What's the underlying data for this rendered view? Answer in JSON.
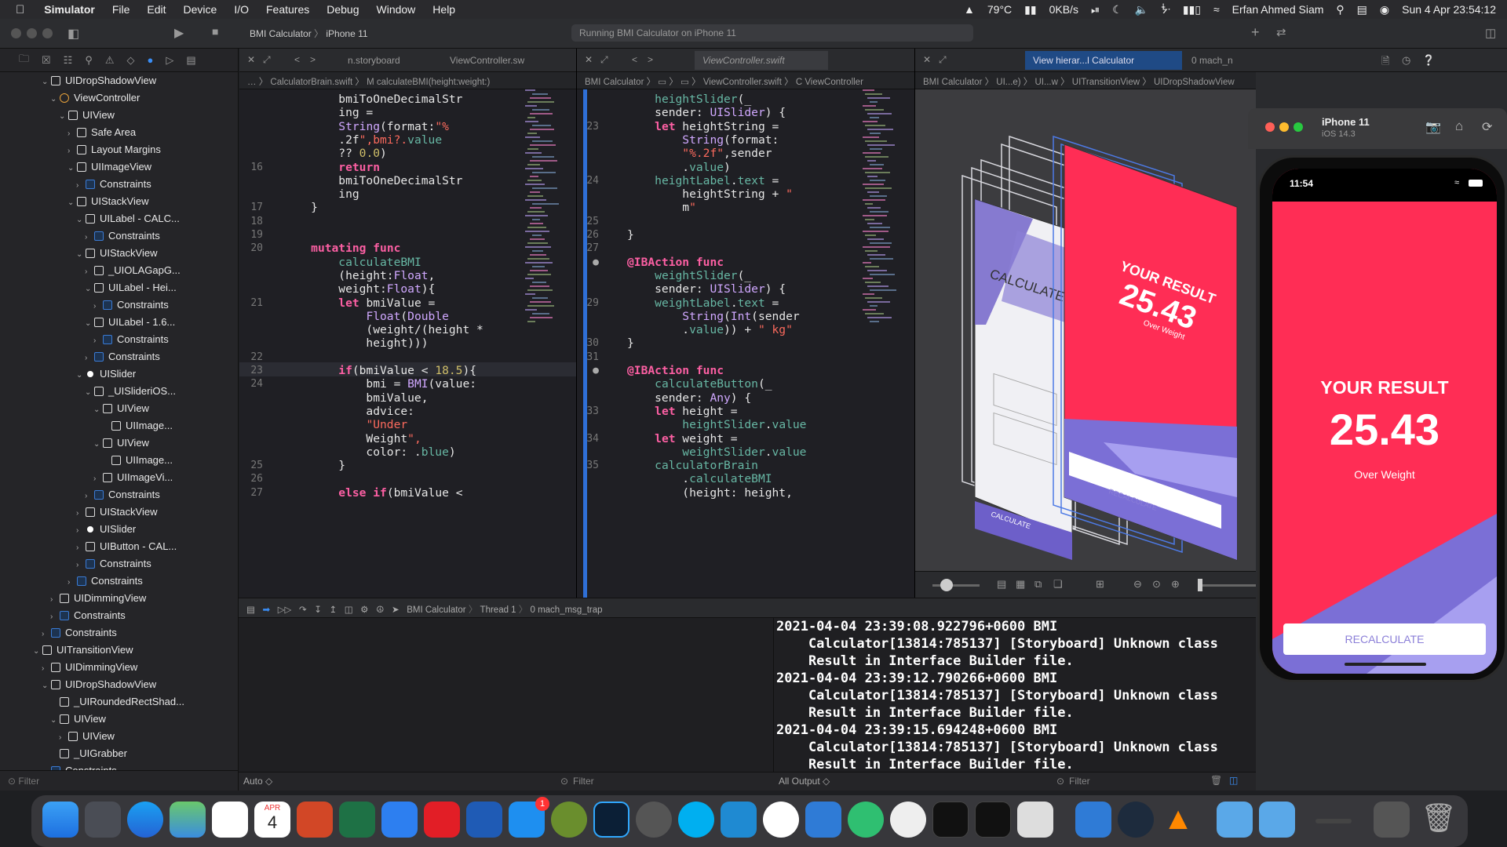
{
  "menubar": {
    "app": "Simulator",
    "items": [
      "File",
      "Edit",
      "Device",
      "I/O",
      "Features",
      "Debug",
      "Window",
      "Help"
    ],
    "temp": "79°C",
    "net": "0KB/s",
    "user": "Erfan Ahmed Siam",
    "clock": "Sun 4 Apr  23:54:12"
  },
  "toolbar": {
    "scheme": "BMI Calculator",
    "device": "iPhone 11",
    "activity": "Running BMI Calculator on iPhone 11"
  },
  "navigator": {
    "filter_placeholder": "Filter",
    "rows": [
      {
        "label": "UIDropShadowView",
        "indent": 5,
        "disc": "⌄",
        "icon": "view"
      },
      {
        "label": "ViewController",
        "indent": 6,
        "disc": "⌄",
        "icon": "vc"
      },
      {
        "label": "UIView",
        "indent": 7,
        "disc": "⌄",
        "icon": "view"
      },
      {
        "label": "Safe Area",
        "indent": 8,
        "disc": "›",
        "icon": "view"
      },
      {
        "label": "Layout Margins",
        "indent": 8,
        "disc": "›",
        "icon": "view"
      },
      {
        "label": "UIImageView",
        "indent": 8,
        "disc": "⌄",
        "icon": "view"
      },
      {
        "label": "Constraints",
        "indent": 9,
        "disc": "›",
        "icon": "cons"
      },
      {
        "label": "UIStackView",
        "indent": 8,
        "disc": "⌄",
        "icon": "view"
      },
      {
        "label": "UILabel - CALC...",
        "indent": 9,
        "disc": "⌄",
        "icon": "view"
      },
      {
        "label": "Constraints",
        "indent": 10,
        "disc": "›",
        "icon": "cons"
      },
      {
        "label": "UIStackView",
        "indent": 9,
        "disc": "⌄",
        "icon": "view"
      },
      {
        "label": "_UIOLAGapG...",
        "indent": 10,
        "disc": "›",
        "icon": "view"
      },
      {
        "label": "UILabel - Hei...",
        "indent": 10,
        "disc": "⌄",
        "icon": "view"
      },
      {
        "label": "Constraints",
        "indent": 11,
        "disc": "›",
        "icon": "cons"
      },
      {
        "label": "UILabel - 1.6...",
        "indent": 10,
        "disc": "⌄",
        "icon": "view"
      },
      {
        "label": "Constraints",
        "indent": 11,
        "disc": "›",
        "icon": "cons"
      },
      {
        "label": "Constraints",
        "indent": 10,
        "disc": "›",
        "icon": "cons"
      },
      {
        "label": "UISlider",
        "indent": 9,
        "disc": "⌄",
        "icon": "dot"
      },
      {
        "label": "_UISlideriOS...",
        "indent": 10,
        "disc": "⌄",
        "icon": "view"
      },
      {
        "label": "UIView",
        "indent": 11,
        "disc": "⌄",
        "icon": "view"
      },
      {
        "label": "UIImage...",
        "indent": 12,
        "disc": "",
        "icon": "view"
      },
      {
        "label": "UIView",
        "indent": 11,
        "disc": "⌄",
        "icon": "view"
      },
      {
        "label": "UIImage...",
        "indent": 12,
        "disc": "",
        "icon": "view"
      },
      {
        "label": "UIImageVi...",
        "indent": 11,
        "disc": "›",
        "icon": "view"
      },
      {
        "label": "Constraints",
        "indent": 10,
        "disc": "›",
        "icon": "cons"
      },
      {
        "label": "UIStackView",
        "indent": 9,
        "disc": "›",
        "icon": "view"
      },
      {
        "label": "UISlider",
        "indent": 9,
        "disc": "›",
        "icon": "dot"
      },
      {
        "label": "UIButton - CAL...",
        "indent": 9,
        "disc": "›",
        "icon": "view"
      },
      {
        "label": "Constraints",
        "indent": 9,
        "disc": "›",
        "icon": "cons"
      },
      {
        "label": "Constraints",
        "indent": 8,
        "disc": "›",
        "icon": "cons"
      },
      {
        "label": "UIDimmingView",
        "indent": 6,
        "disc": "›",
        "icon": "view"
      },
      {
        "label": "Constraints",
        "indent": 6,
        "disc": "›",
        "icon": "cons"
      },
      {
        "label": "Constraints",
        "indent": 5,
        "disc": "›",
        "icon": "cons"
      },
      {
        "label": "UITransitionView",
        "indent": 4,
        "disc": "⌄",
        "icon": "view"
      },
      {
        "label": "UIDimmingView",
        "indent": 5,
        "disc": "›",
        "icon": "view"
      },
      {
        "label": "UIDropShadowView",
        "indent": 5,
        "disc": "⌄",
        "icon": "view"
      },
      {
        "label": "_UIRoundedRectShad...",
        "indent": 6,
        "disc": "",
        "icon": "view"
      },
      {
        "label": "UIView",
        "indent": 6,
        "disc": "⌄",
        "icon": "view"
      },
      {
        "label": "UIView",
        "indent": 7,
        "disc": "›",
        "icon": "view"
      },
      {
        "label": "_UIGrabber",
        "indent": 6,
        "disc": "",
        "icon": "view"
      },
      {
        "label": "Constraints",
        "indent": 5,
        "disc": "›",
        "icon": "cons"
      }
    ]
  },
  "editor1": {
    "tab": "n.storyboard",
    "tab2": "ViewController.sw",
    "jump": "…  〉 CalculatorBrain.swift 〉 M  calculateBMI(height:weight:)",
    "lines": [
      {
        "n": "",
        "t": "        bmiToOneDecimalStr"
      },
      {
        "n": "",
        "t": "        ing ="
      },
      {
        "n": "",
        "t": "        String(format:\"%"
      },
      {
        "n": "",
        "t": "        .2f\",bmi?.value"
      },
      {
        "n": "",
        "t": "        ?? 0.0)"
      },
      {
        "n": "16",
        "t": "        return"
      },
      {
        "n": "",
        "t": "        bmiToOneDecimalStr"
      },
      {
        "n": "",
        "t": "        ing"
      },
      {
        "n": "17",
        "t": "    }"
      },
      {
        "n": "18",
        "t": ""
      },
      {
        "n": "19",
        "t": ""
      },
      {
        "n": "20",
        "t": "    mutating func"
      },
      {
        "n": "",
        "t": "        calculateBMI"
      },
      {
        "n": "",
        "t": "        (height:Float,"
      },
      {
        "n": "",
        "t": "        weight:Float){"
      },
      {
        "n": "21",
        "t": "        let bmiValue ="
      },
      {
        "n": "",
        "t": "            Float(Double"
      },
      {
        "n": "",
        "t": "            (weight/(height *"
      },
      {
        "n": "",
        "t": "            height)))"
      },
      {
        "n": "22",
        "t": ""
      },
      {
        "n": "23",
        "t": "        if(bmiValue < 18.5){"
      },
      {
        "n": "24",
        "t": "            bmi = BMI(value:"
      },
      {
        "n": "",
        "t": "            bmiValue,"
      },
      {
        "n": "",
        "t": "            advice:"
      },
      {
        "n": "",
        "t": "            \"Under"
      },
      {
        "n": "",
        "t": "            Weight\","
      },
      {
        "n": "",
        "t": "            color: .blue)"
      },
      {
        "n": "25",
        "t": "        }"
      },
      {
        "n": "26",
        "t": ""
      },
      {
        "n": "27",
        "t": "        else if(bmiValue <"
      }
    ]
  },
  "editor2": {
    "tab": "ViewController.swift",
    "jump": "BMI Calculator 〉 ▭ 〉 ▭ 〉 ViewController.swift 〉 C  ViewController",
    "lines": [
      {
        "n": "",
        "t": "    heightSlider(_"
      },
      {
        "n": "",
        "t": "    sender: UISlider) {"
      },
      {
        "n": "23",
        "t": "    let heightString ="
      },
      {
        "n": "",
        "t": "        String(format:"
      },
      {
        "n": "",
        "t": "        \"%.2f\",sender"
      },
      {
        "n": "",
        "t": "        .value)"
      },
      {
        "n": "24",
        "t": "    heightLabel.text ="
      },
      {
        "n": "",
        "t": "        heightString + \""
      },
      {
        "n": "",
        "t": "        m\""
      },
      {
        "n": "25",
        "t": ""
      },
      {
        "n": "26",
        "t": "}"
      },
      {
        "n": "27",
        "t": ""
      },
      {
        "n": "●",
        "t": "@IBAction func"
      },
      {
        "n": "",
        "t": "    weightSlider(_"
      },
      {
        "n": "",
        "t": "    sender: UISlider) {"
      },
      {
        "n": "29",
        "t": "    weightLabel.text ="
      },
      {
        "n": "",
        "t": "        String(Int(sender"
      },
      {
        "n": "",
        "t": "        .value)) + \" kg\""
      },
      {
        "n": "30",
        "t": "}"
      },
      {
        "n": "31",
        "t": ""
      },
      {
        "n": "●",
        "t": "@IBAction func"
      },
      {
        "n": "",
        "t": "    calculateButton(_"
      },
      {
        "n": "",
        "t": "    sender: Any) {"
      },
      {
        "n": "33",
        "t": "    let height ="
      },
      {
        "n": "",
        "t": "        heightSlider.value"
      },
      {
        "n": "34",
        "t": "    let weight ="
      },
      {
        "n": "",
        "t": "        weightSlider.value"
      },
      {
        "n": "35",
        "t": "    calculatorBrain"
      },
      {
        "n": "",
        "t": "        .calculateBMI"
      },
      {
        "n": "",
        "t": "        (height: height,"
      }
    ]
  },
  "viewdebugger": {
    "tab": "View hierar...l Calculator",
    "tab2": "0 mach_n",
    "jump": "BMI Calculator 〉 UI...e) 〉 UI...w 〉 UITransitionView 〉 UIDropShadowView",
    "card_result": "YOUR RESULT",
    "card_value": "25.43",
    "card_advice": "Over Weight",
    "card_calc": "CALCULATE YOUR BMI",
    "card_recalc": "RECALCULATE",
    "card_btn": "CALCULATE"
  },
  "debugbar": {
    "scheme": "BMI Calculator",
    "thread": "Thread 1",
    "frame": "0 mach_msg_trap",
    "auto": "Auto ◇",
    "output": "All Output ◇",
    "filter": "Filter"
  },
  "console": {
    "lines": [
      "2021-04-04 23:39:08.922796+0600 BMI",
      "    Calculator[13814:785137] [Storyboard] Unknown class",
      "    Result in Interface Builder file.",
      "2021-04-04 23:39:12.790266+0600 BMI",
      "    Calculator[13814:785137] [Storyboard] Unknown class",
      "    Result in Interface Builder file.",
      "2021-04-04 23:39:15.694248+0600 BMI",
      "    Calculator[13814:785137] [Storyboard] Unknown class",
      "    Result in Interface Builder file."
    ]
  },
  "simulator": {
    "device": "iPhone 11",
    "os": "iOS 14.3",
    "time": "11:54",
    "result_title": "YOUR RESULT",
    "result_value": "25.43",
    "advice": "Over Weight",
    "button": "RECALCULATE"
  },
  "dock": {
    "calendar_month": "APR",
    "calendar_day": "4",
    "badge": "1"
  },
  "colors": {
    "accent": "#ff2d55",
    "purple": "#7b6fd6",
    "recalc_text": "#8b7fd8"
  }
}
